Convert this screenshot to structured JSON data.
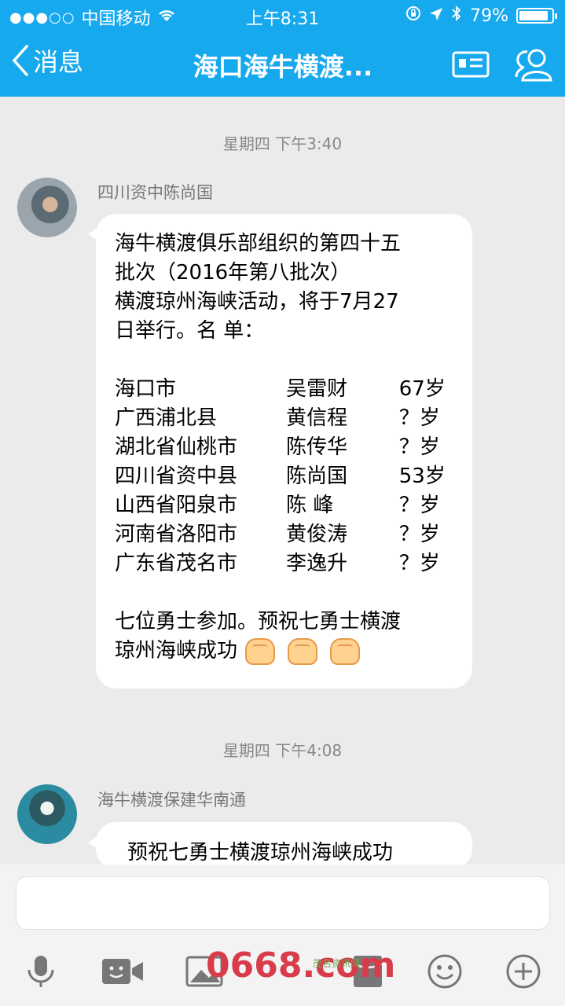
{
  "status": {
    "carrier": "中国移动",
    "time": "上午8:31",
    "battery": "79%",
    "battery_level": 0.79
  },
  "nav": {
    "back_label": "消息",
    "title": "海口海牛横渡..."
  },
  "messages": [
    {
      "timestamp": "星期四 下午3:40",
      "sender": "四川资中陈尚国",
      "intro": "海牛横渡俱乐部组织的第四十五\n批次（2016年第八批次）\n横渡琼州海峡活动，将于7月27\n日举行。名 单：",
      "roster": [
        {
          "loc": "海口市",
          "name": "吴雷财",
          "age": "67岁"
        },
        {
          "loc": "广西浦北县",
          "name": "黄信程",
          "age": "？岁"
        },
        {
          "loc": "湖北省仙桃市",
          "name": "陈传华",
          "age": "？岁"
        },
        {
          "loc": "四川省资中县",
          "name": "陈尚国",
          "age": "53岁"
        },
        {
          "loc": "山西省阳泉市",
          "name": "陈  峰",
          "age": "？岁"
        },
        {
          "loc": "河南省洛阳市",
          "name": "黄俊涛",
          "age": "？岁"
        },
        {
          "loc": "广东省茂名市",
          "name": "李逸升",
          "age": "？岁"
        }
      ],
      "closing": "七位勇士参加。预祝七勇士横渡\n琼州海峡成功"
    },
    {
      "timestamp": "星期四 下午4:08",
      "sender": "海牛横渡保建华南通",
      "text": "预祝七勇士横渡琼州海峡成功"
    }
  ],
  "watermark": {
    "main": "0668.com",
    "small": "茂名资讯网"
  },
  "colors": {
    "header": "#17a9ee",
    "background": "#ebebeb",
    "bubble": "#ffffff"
  },
  "icons": [
    "back-chevron-icon",
    "profile-card-icon",
    "group-members-icon",
    "microphone-icon",
    "video-call-icon",
    "image-icon",
    "red-packet-icon",
    "emoji-icon",
    "add-icon"
  ]
}
